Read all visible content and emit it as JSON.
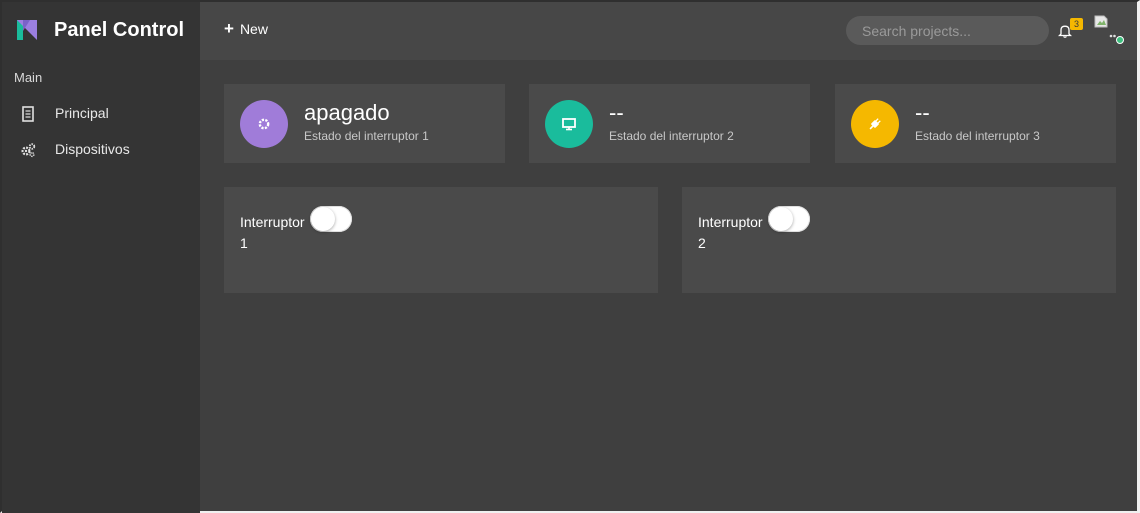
{
  "brand": {
    "title": "Panel Control",
    "logo_icon": "brand-logo-icon"
  },
  "sidebar": {
    "section": "Main",
    "items": [
      {
        "label": "Principal",
        "icon": "document-icon"
      },
      {
        "label": "Dispositivos",
        "icon": "gears-icon"
      }
    ]
  },
  "topbar": {
    "new_label": "New",
    "search_placeholder": "Search projects...",
    "notification_count": "3"
  },
  "stats": [
    {
      "value": "apagado",
      "desc": "Estado del interruptor 1",
      "color": "#a07cd9",
      "icon": "gear-icon"
    },
    {
      "value": "--",
      "desc": "Estado del interruptor 2",
      "color": "#1abc9c",
      "icon": "monitor-icon"
    },
    {
      "value": "--",
      "desc": "Estado del interruptor 3",
      "color": "#f5b800",
      "icon": "plug-icon"
    }
  ],
  "switches": [
    {
      "label": "Interruptor",
      "number": "1",
      "on": false
    },
    {
      "label": "Interruptor",
      "number": "2",
      "on": false
    }
  ],
  "colors": {
    "sidebar_bg": "#343434",
    "topbar_bg": "#474747",
    "content_bg": "#3f3f3f",
    "card_bg": "#4a4a4a",
    "badge": "#f5b800",
    "online_dot": "#3fbf7f"
  }
}
